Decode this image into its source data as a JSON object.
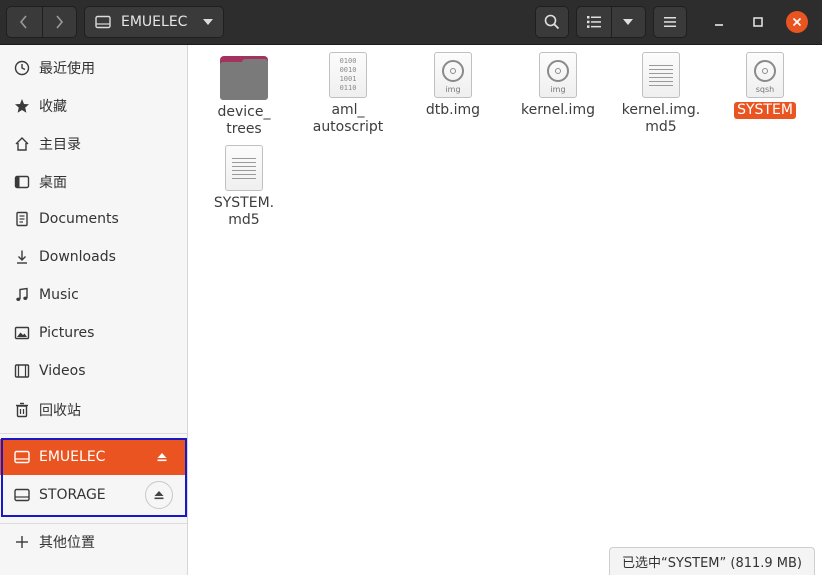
{
  "header": {
    "path_label": "EMUELEC",
    "icons": {
      "back": "chevron-left-icon",
      "forward": "chevron-right-icon",
      "drive": "drive-icon",
      "search": "search-icon",
      "list_view": "list-view-icon",
      "view_options": "chevron-down-icon",
      "menu": "hamburger-menu-icon",
      "minimize": "minimize-icon",
      "maximize": "maximize-icon",
      "close": "close-icon"
    }
  },
  "sidebar": {
    "items": [
      {
        "label": "最近使用",
        "icon": "clock-icon"
      },
      {
        "label": "收藏",
        "icon": "star-icon"
      },
      {
        "label": "主目录",
        "icon": "home-icon"
      },
      {
        "label": "桌面",
        "icon": "desktop-icon"
      },
      {
        "label": "Documents",
        "icon": "document-icon"
      },
      {
        "label": "Downloads",
        "icon": "download-icon"
      },
      {
        "label": "Music",
        "icon": "music-icon"
      },
      {
        "label": "Pictures",
        "icon": "picture-icon"
      },
      {
        "label": "Videos",
        "icon": "video-icon"
      },
      {
        "label": "回收站",
        "icon": "trash-icon"
      }
    ],
    "devices": [
      {
        "label": "EMUELEC",
        "icon": "drive-icon",
        "active": true
      },
      {
        "label": "STORAGE",
        "icon": "drive-icon",
        "active": false
      }
    ],
    "other": {
      "label": "其他位置",
      "icon": "plus-icon"
    }
  },
  "files": [
    {
      "name_line1": "device_",
      "name_line2": "trees",
      "type": "folder"
    },
    {
      "name_line1": "aml_",
      "name_line2": "autoscript",
      "type": "binary",
      "bin_lines": [
        "0100",
        "0010",
        "1001",
        "0110"
      ]
    },
    {
      "name_line1": "dtb.img",
      "name_line2": "",
      "type": "disc",
      "tag": "img"
    },
    {
      "name_line1": "kernel.img",
      "name_line2": "",
      "type": "disc",
      "tag": "img"
    },
    {
      "name_line1": "kernel.img.",
      "name_line2": "md5",
      "type": "text"
    },
    {
      "name_line1": "SYSTEM",
      "name_line2": "",
      "type": "disc",
      "tag": "sqsh",
      "selected": true
    },
    {
      "name_line1": "SYSTEM.",
      "name_line2": "md5",
      "type": "text"
    }
  ],
  "status": {
    "text": "已选中“SYSTEM” (811.9 MB)"
  },
  "colors": {
    "accent": "#e95420",
    "headerbar": "#2d2d2d",
    "sidebar": "#f6f6f6",
    "highlight_box": "#1818c8"
  }
}
